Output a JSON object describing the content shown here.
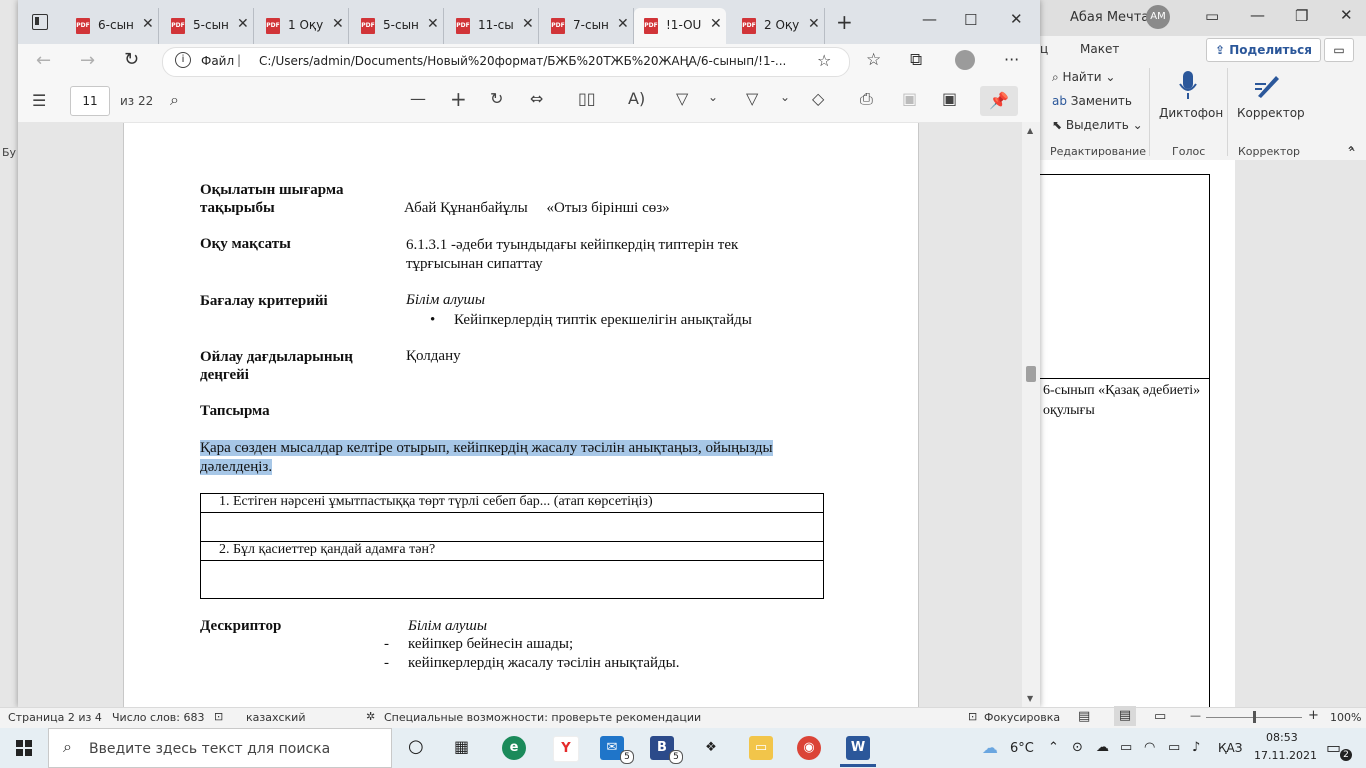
{
  "word": {
    "user_name": "Абая Мечта",
    "user_initials": "AM",
    "tabs": [
      "ц",
      "Макет"
    ],
    "share_label": "Поделиться",
    "edit_cmds": [
      "Найти",
      "Заменить",
      "Выделить"
    ],
    "group_edit": "Редактирование",
    "dictate": "Диктофон",
    "group_voice": "Голос",
    "editor": "Корректор",
    "group_editor": "Корректор",
    "left_cut": "Бу",
    "page_text": "6-сынып «Қазақ әдебиеті» оқулығы"
  },
  "edge": {
    "tabs": [
      {
        "title": "6-сын"
      },
      {
        "title": "5-сын"
      },
      {
        "title": "1 Оқу"
      },
      {
        "title": "5-сын"
      },
      {
        "title": "11-сы"
      },
      {
        "title": "7-сын"
      },
      {
        "title": "!1-OU"
      },
      {
        "title": "2 Оқу"
      }
    ],
    "address_prefix": "Файл",
    "address": "C:/Users/admin/Documents/Новый%20формат/БЖБ%20ТЖБ%20ЖАҢА/6-сынып/!1-...",
    "page_current": "11",
    "page_total": "из 22"
  },
  "document": {
    "title_label": "Оқылатын шығарма тақырыбы",
    "title_label_1": "Оқылатын шығарма",
    "title_label_2": "тақырыбы",
    "title_value": "Абай Құнанбайұлы     «Отыз бірінші сөз»",
    "goal_label": "Оқу мақсаты",
    "goal_value_1": "6.1.3.1 -әдеби туындыдағы кейіпкердің типтерін тек",
    "goal_value_2": "тұрғысынан сипаттау",
    "criteria_label": "Бағалау критерийі",
    "criteria_sub": "Білім алушы",
    "criteria_item": "Кейіпкерлердің типтік ерекшелігін анықтайды",
    "level_label_1": "Ойлау дағдыларының",
    "level_label_2": "деңгейі",
    "level_value": "Қолдану",
    "task_label": "Тапсырма",
    "task_text_1": "Қара сөзден мысалдар келтіре отырып, кейіпкердің жасалу тәсілін анықтаңыз, ойыңызды",
    "task_text_2": "дәлелдеңіз.",
    "q1": "1.  Естіген нәрсені ұмытпастыққа төрт түрлі себеп бар... (атап көрсетіңіз)",
    "q2": "2.  Бұл қасиеттер қандай адамға тән?",
    "descriptor_label": "Дескриптор",
    "descriptor_sub": "Білім алушы",
    "descriptor_items": [
      "кейіпкер бейнесін ашады;",
      "кейіпкерлердің жасалу тәсілін анықтайды."
    ]
  },
  "statusbar": {
    "page": "Страница 2 из 4",
    "words": "Число слов: 683",
    "lang": "казахский",
    "accessibility": "Специальные возможности: проверьте рекомендации",
    "focus": "Фокусировка",
    "zoom": "100%"
  },
  "taskbar": {
    "search_placeholder": "Введите здесь текст для поиска",
    "badge_mail": "5",
    "badge_b": "5",
    "weather": "6°C",
    "lang": "ҚАЗ",
    "time": "08:53",
    "date": "17.11.2021",
    "notif_count": "2"
  },
  "colors": {
    "pdf_red": "#d13438",
    "highlight": "#a7c7e7",
    "word_blue": "#2b579a"
  }
}
